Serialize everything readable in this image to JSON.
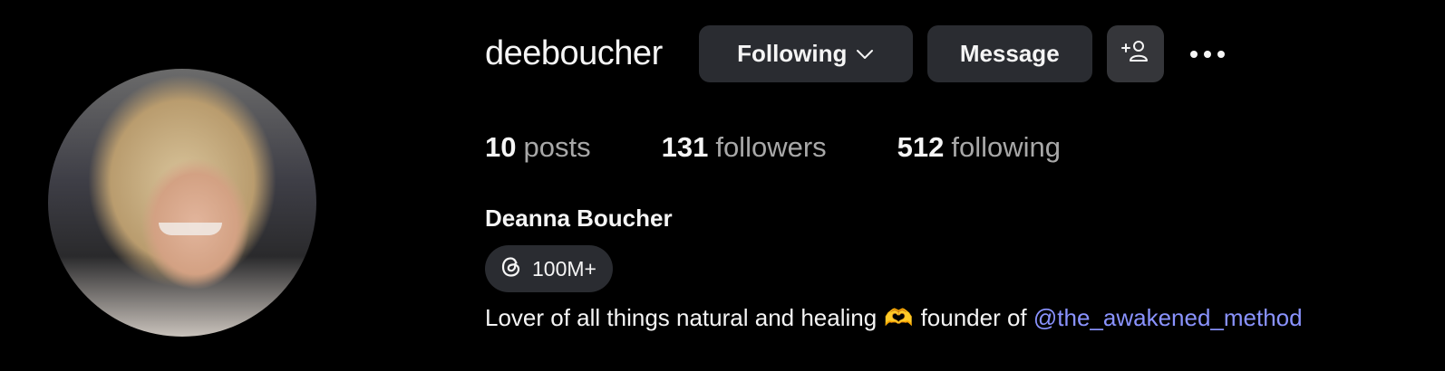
{
  "profile": {
    "username": "deeboucher",
    "full_name": "Deanna Boucher",
    "avatar_icon": "profile-photo"
  },
  "actions": {
    "following_label": "Following",
    "message_label": "Message",
    "suggest_icon": "add-person-icon",
    "more_icon": "more-options-icon"
  },
  "stats": [
    {
      "value": "10",
      "label": "posts"
    },
    {
      "value": "131",
      "label": "followers"
    },
    {
      "value": "512",
      "label": "following"
    }
  ],
  "threads": {
    "icon": "threads-icon",
    "count": "100M+"
  },
  "bio": {
    "text_before": "Lover of all things natural and healing",
    "emoji": "🫶",
    "text_middle": "founder of",
    "mention": "@the_awakened_method"
  },
  "colors": {
    "background": "#000000",
    "button": "#2a2c31",
    "muted_text": "#a8a8a8",
    "link": "#8a93ff"
  }
}
